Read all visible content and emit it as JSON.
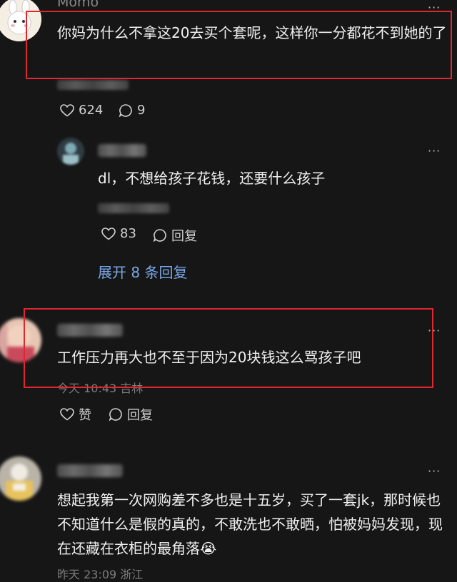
{
  "comments": [
    {
      "author": "Momo",
      "text": "你妈为什么不拿这20去买个套呢，这样你一分都花不到她的了",
      "likes": "624",
      "replies": "9"
    },
    {
      "text": "dl，不想给孩子花钱，还要什么孩子",
      "likes": "83",
      "reply_label": "回复",
      "expand_label": "展开 8 条回复"
    },
    {
      "text": "工作压力再大也不至于因为20块钱这么骂孩子吧",
      "meta": "今天 10:43 吉林",
      "like_label": "赞",
      "reply_label": "回复"
    },
    {
      "text": "想起我第一次网购差不多也是十五岁，买了一套jk，那时候也不知道什么是假的真的，不敢洗也不敢晒，怕被妈妈发现，现在还藏在衣柜的最角落😭",
      "meta": "昨天 23:09 浙江"
    }
  ],
  "more_menu": "···",
  "colors": {
    "highlight_box": "#e0262e",
    "link": "#7aa7e6"
  }
}
